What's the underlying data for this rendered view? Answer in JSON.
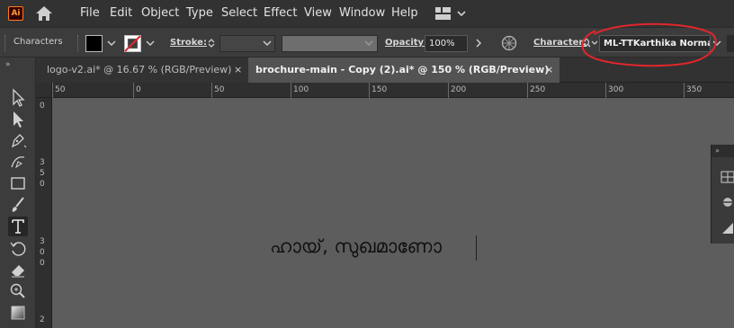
{
  "app": {
    "logo_text": "Ai",
    "brand_color": "#ff9a00"
  },
  "menubar": {
    "items": [
      "File",
      "Edit",
      "Object",
      "Type",
      "Select",
      "Effect",
      "View",
      "Window",
      "Help"
    ]
  },
  "controlbar": {
    "panel_label": "Characters",
    "stroke_label": "Stroke:",
    "opacity_label": "Opacity:",
    "opacity_value": "100%",
    "character_label": "Character:",
    "font_value": "ML-TTKarthika Normal",
    "fill_color": "#000000",
    "stroke_color": "none"
  },
  "tabs": [
    {
      "label": "logo-v2.ai* @ 16.67 % (RGB/Preview)",
      "active": false,
      "close": "×"
    },
    {
      "label": "brochure-main - Copy (2).ai* @ 150 % (RGB/Preview)",
      "active": true,
      "close": "×"
    }
  ],
  "toolbar": {
    "collapse_label": "»",
    "tools": [
      "selection-tool",
      "direct-selection-tool",
      "pen-tool",
      "curvature-tool",
      "rectangle-tool",
      "paintbrush-tool",
      "type-tool",
      "rotate-tool",
      "eraser-tool",
      "zoom-tool",
      "gradient-tool"
    ],
    "active_tool": "type-tool"
  },
  "rulers": {
    "horizontal": [
      "50",
      "0",
      "50",
      "100",
      "150",
      "200",
      "250",
      "300",
      "350"
    ],
    "vertical_0": "0",
    "vertical_1": [
      "3",
      "5",
      "0"
    ],
    "vertical_2": [
      "3",
      "0",
      "0"
    ],
    "vertical_3": "2"
  },
  "canvas": {
    "text": "ഹായ്, സുഖമാണോ"
  },
  "right_panel": {
    "collapse_label": "»"
  },
  "annotation": {
    "color": "#e0262c"
  }
}
